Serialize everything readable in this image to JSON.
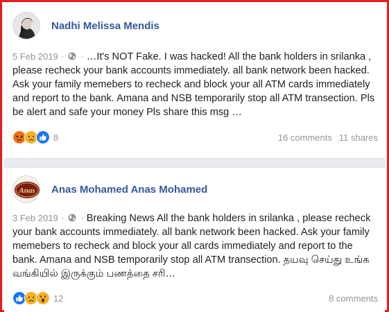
{
  "posts": [
    {
      "author": "Nadhi Melissa Mendis",
      "date": "5 Feb 2019",
      "separator": "·",
      "text": "…It's NOT Fake. I was hacked! All the bank holders in srilanka , please recheck your bank accounts immediately. all bank network been hacked. Ask your family memebers to recheck and block your all ATM cards immediately and report to the bank. Amana and NSB temporarily stop all ATM transection. Pls be alert and safe your money Pls share this msg …",
      "reactions": [
        "angry",
        "sad",
        "like"
      ],
      "reaction_count": "8",
      "comments": "16 comments",
      "shares": "11 shares"
    },
    {
      "author": "Anas Mohamed Anas Mohamed",
      "date": "3 Feb 2019",
      "separator": "·",
      "text": "Breaking News All the bank holders in srilanka , please recheck your bank accounts immediately. all bank network been hacked. Ask your family memebers to recheck and block your all cards immediately and report to the bank. Amana and NSB temporarily stop all ATM transection. தயவு செய்து உங்க வங்கியில் இருக்கும் பணத்தை சரி…",
      "reactions": [
        "like",
        "sad",
        "wow"
      ],
      "reaction_count": "12",
      "comments": "8 comments",
      "avatar_logo_text": "Anas"
    }
  ],
  "colors": {
    "frame": "#e41e1e",
    "author": "#365899",
    "meta": "#90949c",
    "like": "#1877f2",
    "angry": "#e9710f",
    "emoji_yellow": "#f7b125"
  }
}
